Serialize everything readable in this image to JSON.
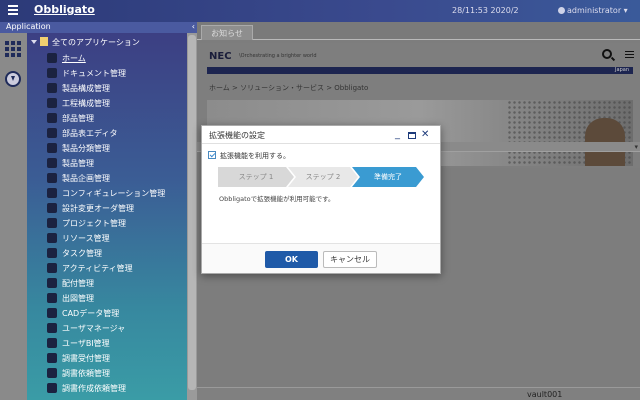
{
  "topbar": {
    "brand": "Obbligato",
    "clock": "28/11:53 2020/2",
    "user": "administrator ▾"
  },
  "app_panel": {
    "title": "Application",
    "collapse": "‹",
    "root": "全てのアプリケーション",
    "items": [
      {
        "label": "ホーム",
        "icon": "home-icon"
      },
      {
        "label": "ドキュメント管理",
        "icon": "document-icon"
      },
      {
        "label": "製品構成管理",
        "icon": "product-structure-icon"
      },
      {
        "label": "工程構成管理",
        "icon": "process-icon"
      },
      {
        "label": "部品管理",
        "icon": "part-icon"
      },
      {
        "label": "部品表エディタ",
        "icon": "bom-editor-icon"
      },
      {
        "label": "製品分類管理",
        "icon": "classification-icon"
      },
      {
        "label": "製品管理",
        "icon": "product-icon"
      },
      {
        "label": "製品企画管理",
        "icon": "planning-icon"
      },
      {
        "label": "コンフィギュレーション管理",
        "icon": "configuration-icon"
      },
      {
        "label": "設計変更オーダ管理",
        "icon": "change-order-icon"
      },
      {
        "label": "プロジェクト管理",
        "icon": "project-icon"
      },
      {
        "label": "リソース管理",
        "icon": "resource-icon"
      },
      {
        "label": "タスク管理",
        "icon": "task-icon"
      },
      {
        "label": "アクティビティ管理",
        "icon": "activity-icon"
      },
      {
        "label": "配付管理",
        "icon": "distribution-icon"
      },
      {
        "label": "出図管理",
        "icon": "drawing-release-icon"
      },
      {
        "label": "CADデータ管理",
        "icon": "cad-icon"
      },
      {
        "label": "ユーザマネージャ",
        "icon": "user-manager-icon"
      },
      {
        "label": "ユーザBI管理",
        "icon": "user-bi-icon"
      },
      {
        "label": "調書受付管理",
        "icon": "reception-icon"
      },
      {
        "label": "調書依頼管理",
        "icon": "request-icon"
      },
      {
        "label": "調書作成依頼管理",
        "icon": "creation-request-icon"
      }
    ]
  },
  "content": {
    "tab": "お知らせ",
    "nec_logo": "NEC",
    "nec_tagline": "\\Orchestrating a brighter world",
    "lang": "Japan",
    "breadcrumb": "ホーム  >  ソリューション・サービス  >  Obbligato",
    "collapse": "▾",
    "footer_text": "vault001"
  },
  "dialog": {
    "title": "拡張機能の設定",
    "checkbox_label": "拡張機能を利用する。",
    "steps": [
      "ステップ 1",
      "ステップ 2",
      "準備完了"
    ],
    "message": "Obbligatoで拡張機能が利用可能です。",
    "ok": "OK",
    "cancel": "キャンセル",
    "minimize": "_",
    "close": "✕"
  },
  "colors": {
    "accent": "#1f5aa8",
    "step_active": "#3a9bd2",
    "topbar": "#2c3a78"
  }
}
